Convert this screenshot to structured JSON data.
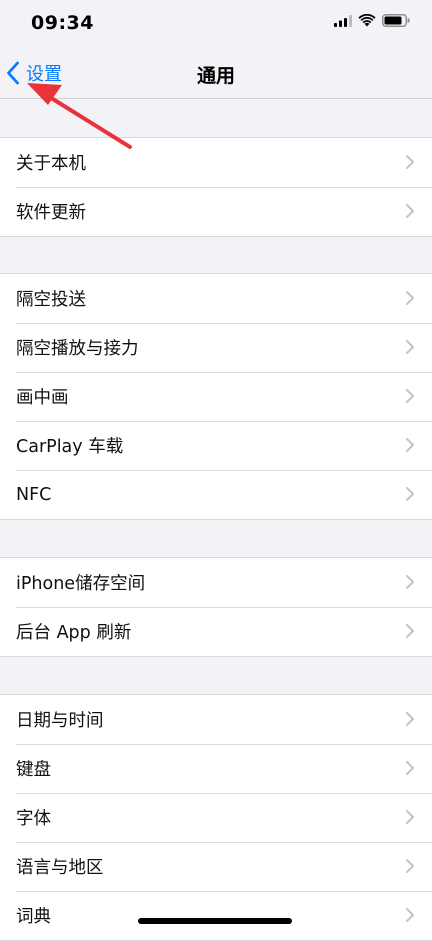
{
  "status_bar": {
    "time": "09:34"
  },
  "nav": {
    "back_label": "设置",
    "title": "通用"
  },
  "groups": [
    {
      "items": [
        "关于本机",
        "软件更新"
      ]
    },
    {
      "items": [
        "隔空投送",
        "隔空播放与接力",
        "画中画",
        "CarPlay 车载",
        "NFC"
      ]
    },
    {
      "items": [
        "iPhone储存空间",
        "后台 App 刷新"
      ]
    },
    {
      "items": [
        "日期与时间",
        "键盘",
        "字体",
        "语言与地区",
        "词典"
      ]
    }
  ],
  "colors": {
    "accent": "#0a7aff",
    "annotation_arrow": "#e8333a",
    "background": "#f2f2f7"
  }
}
